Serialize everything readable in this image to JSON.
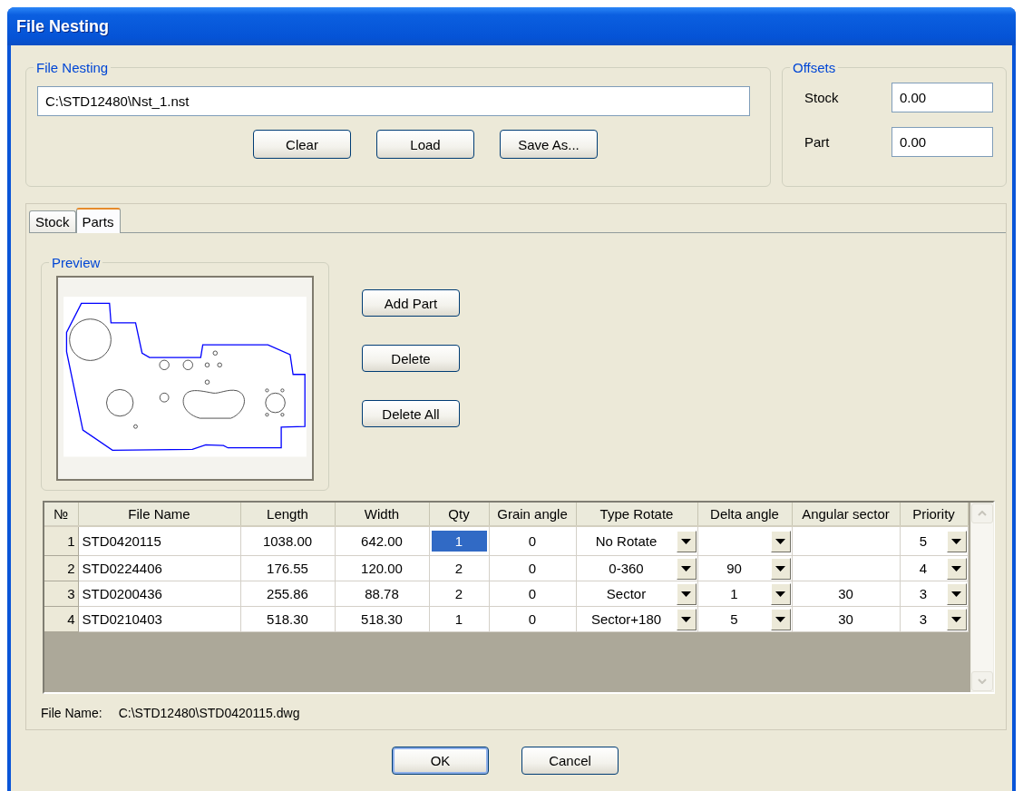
{
  "window": {
    "title": "File Nesting"
  },
  "file_nesting": {
    "legend": "File Nesting",
    "path": "C:\\STD12480\\Nst_1.nst",
    "buttons": [
      "Clear",
      "Load",
      "Save As..."
    ]
  },
  "offsets": {
    "legend": "Offsets",
    "fields": [
      {
        "label": "Stock",
        "value": "0.00"
      },
      {
        "label": "Part",
        "value": "0.00"
      }
    ]
  },
  "tabs": [
    {
      "label": "Stock",
      "selected": false
    },
    {
      "label": "Parts",
      "selected": true
    }
  ],
  "preview": {
    "legend": "Preview"
  },
  "part_buttons": [
    "Add Part",
    "Delete",
    "Delete All"
  ],
  "table": {
    "columns": [
      {
        "label": "№",
        "kind": "index"
      },
      {
        "label": "File Name",
        "kind": "name"
      },
      {
        "label": "Length",
        "kind": "text"
      },
      {
        "label": "Width",
        "kind": "text"
      },
      {
        "label": "Qty",
        "kind": "text"
      },
      {
        "label": "Grain angle",
        "kind": "text"
      },
      {
        "label": "Type Rotate",
        "kind": "combo"
      },
      {
        "label": "Delta angle",
        "kind": "combo"
      },
      {
        "label": "Angular sector",
        "kind": "text"
      },
      {
        "label": "Priority",
        "kind": "combo"
      }
    ],
    "rows": [
      {
        "cells": [
          {
            "text": "1",
            "selected": false
          },
          {
            "text": "STD0420115",
            "selected": false
          },
          {
            "text": "1038.00",
            "selected": false
          },
          {
            "text": "642.00",
            "selected": false
          },
          {
            "text": "1",
            "selected": true
          },
          {
            "text": "0",
            "selected": false
          },
          {
            "text": "No Rotate",
            "selected": false
          },
          {
            "selected": false
          },
          {
            "selected": false
          },
          {
            "text": "5",
            "selected": false
          }
        ]
      },
      {
        "cells": [
          {
            "text": "2",
            "selected": false
          },
          {
            "text": "STD0224406",
            "selected": false
          },
          {
            "text": "176.55",
            "selected": false
          },
          {
            "text": "120.00",
            "selected": false
          },
          {
            "text": "2",
            "selected": false
          },
          {
            "text": "0",
            "selected": false
          },
          {
            "text": "0-360",
            "selected": false
          },
          {
            "text": "90",
            "selected": false
          },
          {
            "selected": false
          },
          {
            "text": "4",
            "selected": false
          }
        ]
      },
      {
        "cells": [
          {
            "text": "3",
            "selected": false
          },
          {
            "text": "STD0200436",
            "selected": false
          },
          {
            "text": "255.86",
            "selected": false
          },
          {
            "text": "88.78",
            "selected": false
          },
          {
            "text": "2",
            "selected": false
          },
          {
            "text": "0",
            "selected": false
          },
          {
            "text": "Sector",
            "selected": false
          },
          {
            "text": "1",
            "selected": false
          },
          {
            "text": "30",
            "selected": false
          },
          {
            "text": "3",
            "selected": false
          }
        ]
      },
      {
        "cells": [
          {
            "text": "4",
            "selected": false
          },
          {
            "text": "STD0210403",
            "selected": false
          },
          {
            "text": "518.30",
            "selected": false
          },
          {
            "text": "518.30",
            "selected": false
          },
          {
            "text": "1",
            "selected": false
          },
          {
            "text": "0",
            "selected": false
          },
          {
            "text": "Sector+180",
            "selected": false
          },
          {
            "text": "5",
            "selected": false
          },
          {
            "text": "30",
            "selected": false
          },
          {
            "text": "3",
            "selected": false
          }
        ]
      }
    ]
  },
  "file_name": {
    "label": "File Name:",
    "value": "C:\\STD12480\\STD0420115.dwg"
  },
  "buttons": [
    {
      "label": "OK",
      "default": true
    },
    {
      "label": "Cancel",
      "default": false
    }
  ]
}
